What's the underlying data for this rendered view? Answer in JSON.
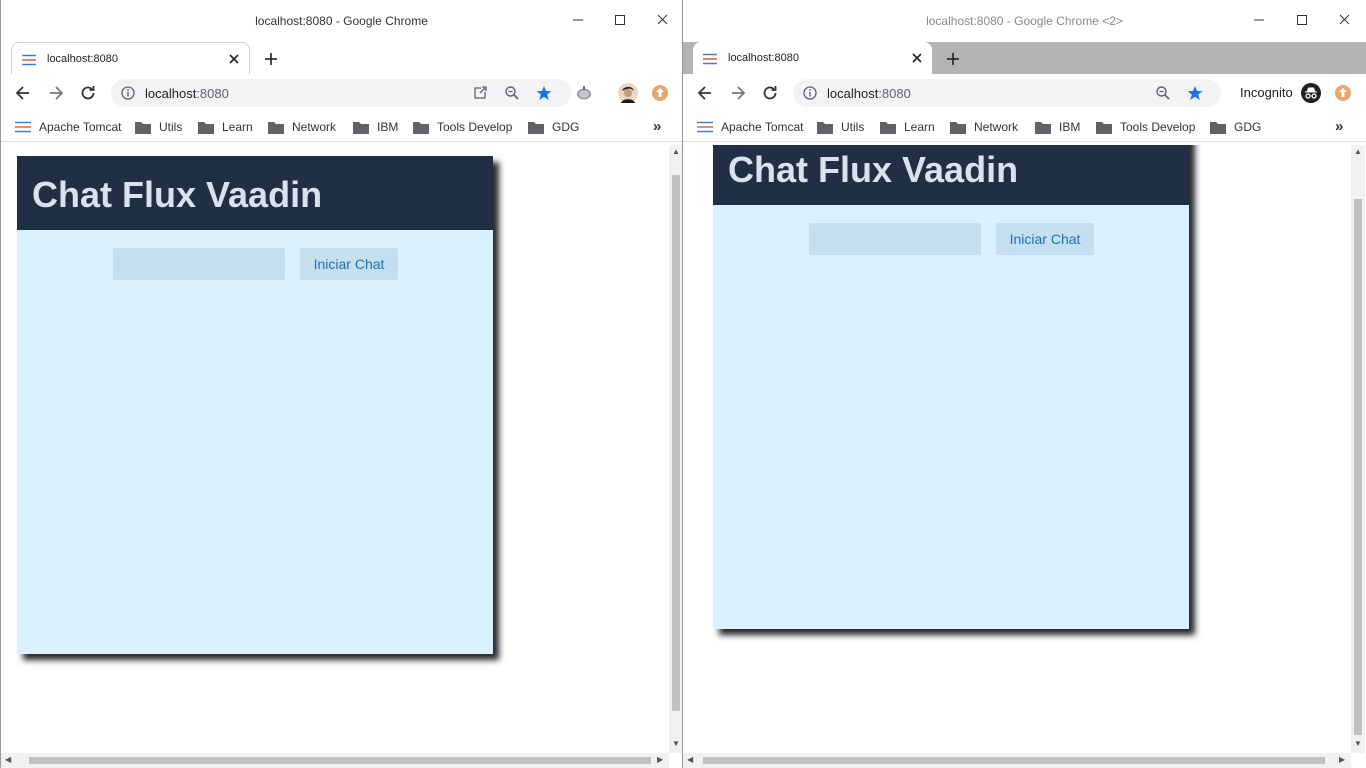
{
  "windows": [
    {
      "title": "localhost:8080 - Google Chrome",
      "tab_title": "localhost:8080",
      "url_host": "localhost",
      "url_port": ":8080",
      "bookmarks": [
        "Apache Tomcat",
        "Utils",
        "Learn",
        "Network",
        "IBM",
        "Tools Develop",
        "GDG"
      ],
      "bookmarks_more": "»",
      "app": {
        "title": "Chat Flux Vaadin",
        "input_placeholder": "",
        "start_button": "Iniciar Chat"
      }
    },
    {
      "title": "localhost:8080 - Google Chrome <2>",
      "tab_title": "localhost:8080",
      "url_host": "localhost",
      "url_port": ":8080",
      "profile_label": "Incognito",
      "bookmarks": [
        "Apache Tomcat",
        "Utils",
        "Learn",
        "Network",
        "IBM",
        "Tools Develop",
        "GDG"
      ],
      "bookmarks_more": "»",
      "app": {
        "title": "Chat Flux Vaadin",
        "input_placeholder": "",
        "start_button": "Iniciar Chat"
      }
    }
  ],
  "colors": {
    "app_header": "#212f45",
    "app_body": "#d8f1fd",
    "app_title": "#d7e3ef",
    "button_text": "#1f6fb8",
    "star": "#1a73e8"
  },
  "icons": [
    "favicon-lines-icon",
    "close-icon",
    "new-tab-icon",
    "back-icon",
    "forward-icon",
    "reload-icon",
    "info-icon",
    "open-in-app-icon",
    "zoom-icon",
    "star-icon",
    "extension-icon",
    "avatar",
    "update-icon",
    "incognito-icon",
    "folder-icon",
    "minimize-icon",
    "maximize-icon"
  ]
}
